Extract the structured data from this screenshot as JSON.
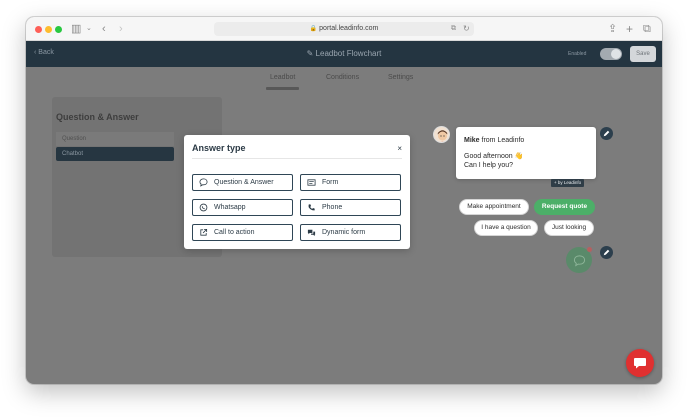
{
  "browser": {
    "url": "portal.leadinfo.com"
  },
  "app": {
    "back_label": "Back",
    "title": "Leadbot Flowchart",
    "enabled_label": "Enabled",
    "save_label": "Save"
  },
  "tabs": [
    {
      "label": "Leadbot",
      "active": true
    },
    {
      "label": "Conditions",
      "active": false
    },
    {
      "label": "Settings",
      "active": false
    }
  ],
  "panel": {
    "heading": "Question & Answer",
    "column_header": "Question",
    "row_value": "Chatbot"
  },
  "modal": {
    "title": "Answer type",
    "close_label": "×",
    "options": [
      {
        "label": "Question & Answer",
        "icon": "chat-bubble-icon"
      },
      {
        "label": "Form",
        "icon": "form-icon"
      },
      {
        "label": "Whatsapp",
        "icon": "whatsapp-icon"
      },
      {
        "label": "Phone",
        "icon": "phone-icon"
      },
      {
        "label": "Call to action",
        "icon": "external-link-icon"
      },
      {
        "label": "Dynamic form",
        "icon": "chat-bubbles-icon"
      }
    ]
  },
  "chat": {
    "sender_name": "Mike",
    "sender_suffix": "from Leadinfo",
    "line1": "Good afternoon 👋",
    "line2": "Can I help you?",
    "by_label": "+ by Leadinfo",
    "quick_replies": [
      {
        "label": "Make appointment",
        "primary": false
      },
      {
        "label": "Request quote",
        "primary": true
      },
      {
        "label": "I have a question",
        "primary": false
      },
      {
        "label": "Just looking",
        "primary": false
      }
    ]
  },
  "colors": {
    "accent_green": "#4caf68",
    "navy": "#243541",
    "help_red": "#e03030"
  }
}
